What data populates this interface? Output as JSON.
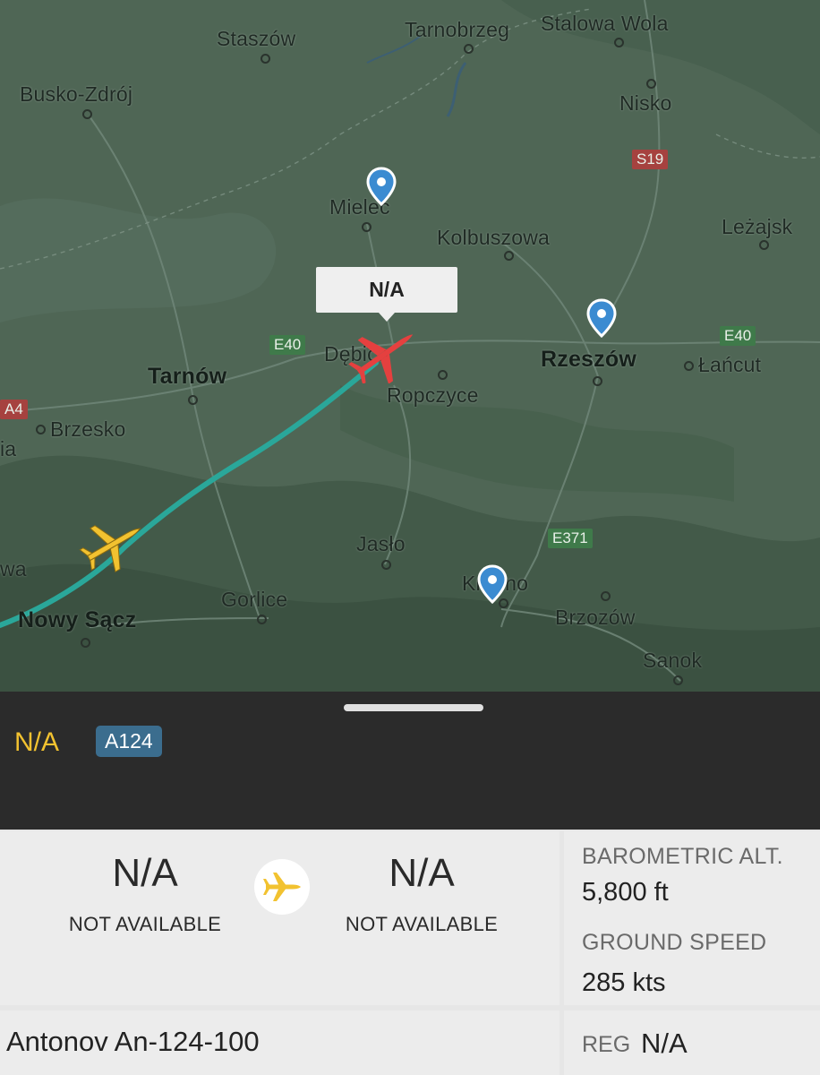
{
  "map": {
    "places": [
      {
        "name": "Staszów"
      },
      {
        "name": "Tarnobrzeg"
      },
      {
        "name": "Stalowa Wola"
      },
      {
        "name": "Busko-Zdrój"
      },
      {
        "name": "Nisko"
      },
      {
        "name": "Mielec"
      },
      {
        "name": "Kolbuszowa"
      },
      {
        "name": "Leżajsk"
      },
      {
        "name": "Tarnów"
      },
      {
        "name": "Dębica"
      },
      {
        "name": "Ropczyce"
      },
      {
        "name": "Rzeszów"
      },
      {
        "name": "Łańcut"
      },
      {
        "name": "Brzesko"
      },
      {
        "name": "Jasło"
      },
      {
        "name": "Krosno"
      },
      {
        "name": "Gorlice"
      },
      {
        "name": "Brzozów"
      },
      {
        "name": "Nowy Sącz"
      },
      {
        "name": "Sanok"
      },
      {
        "name": "ia"
      },
      {
        "name": "wa"
      }
    ],
    "roads": [
      {
        "label": "S19",
        "color": "red"
      },
      {
        "label": "E40",
        "color": "green"
      },
      {
        "label": "E40",
        "color": "green"
      },
      {
        "label": "A4",
        "color": "red"
      },
      {
        "label": "E371",
        "color": "green"
      }
    ],
    "selected_callout": "N/A"
  },
  "flight": {
    "callsign": "N/A",
    "type_code": "A124",
    "origin": {
      "code": "N/A",
      "city": "NOT AVAILABLE"
    },
    "destination": {
      "code": "N/A",
      "city": "NOT AVAILABLE"
    },
    "barometric_alt_label": "BAROMETRIC ALT.",
    "barometric_alt_value": "5,800 ft",
    "ground_speed_label": "GROUND SPEED",
    "ground_speed_value": "285 kts",
    "aircraft_name": "Antonov An-124-100",
    "reg_label": "REG",
    "reg_value": "N/A"
  },
  "colors": {
    "map_bg": "#4f6655",
    "track": "#2aa79a",
    "selected_plane": "#e5403f",
    "other_plane": "#f2c230",
    "pin": "#3b8bd1",
    "callsign": "#f2c230",
    "badge": "#3b6d8e"
  }
}
